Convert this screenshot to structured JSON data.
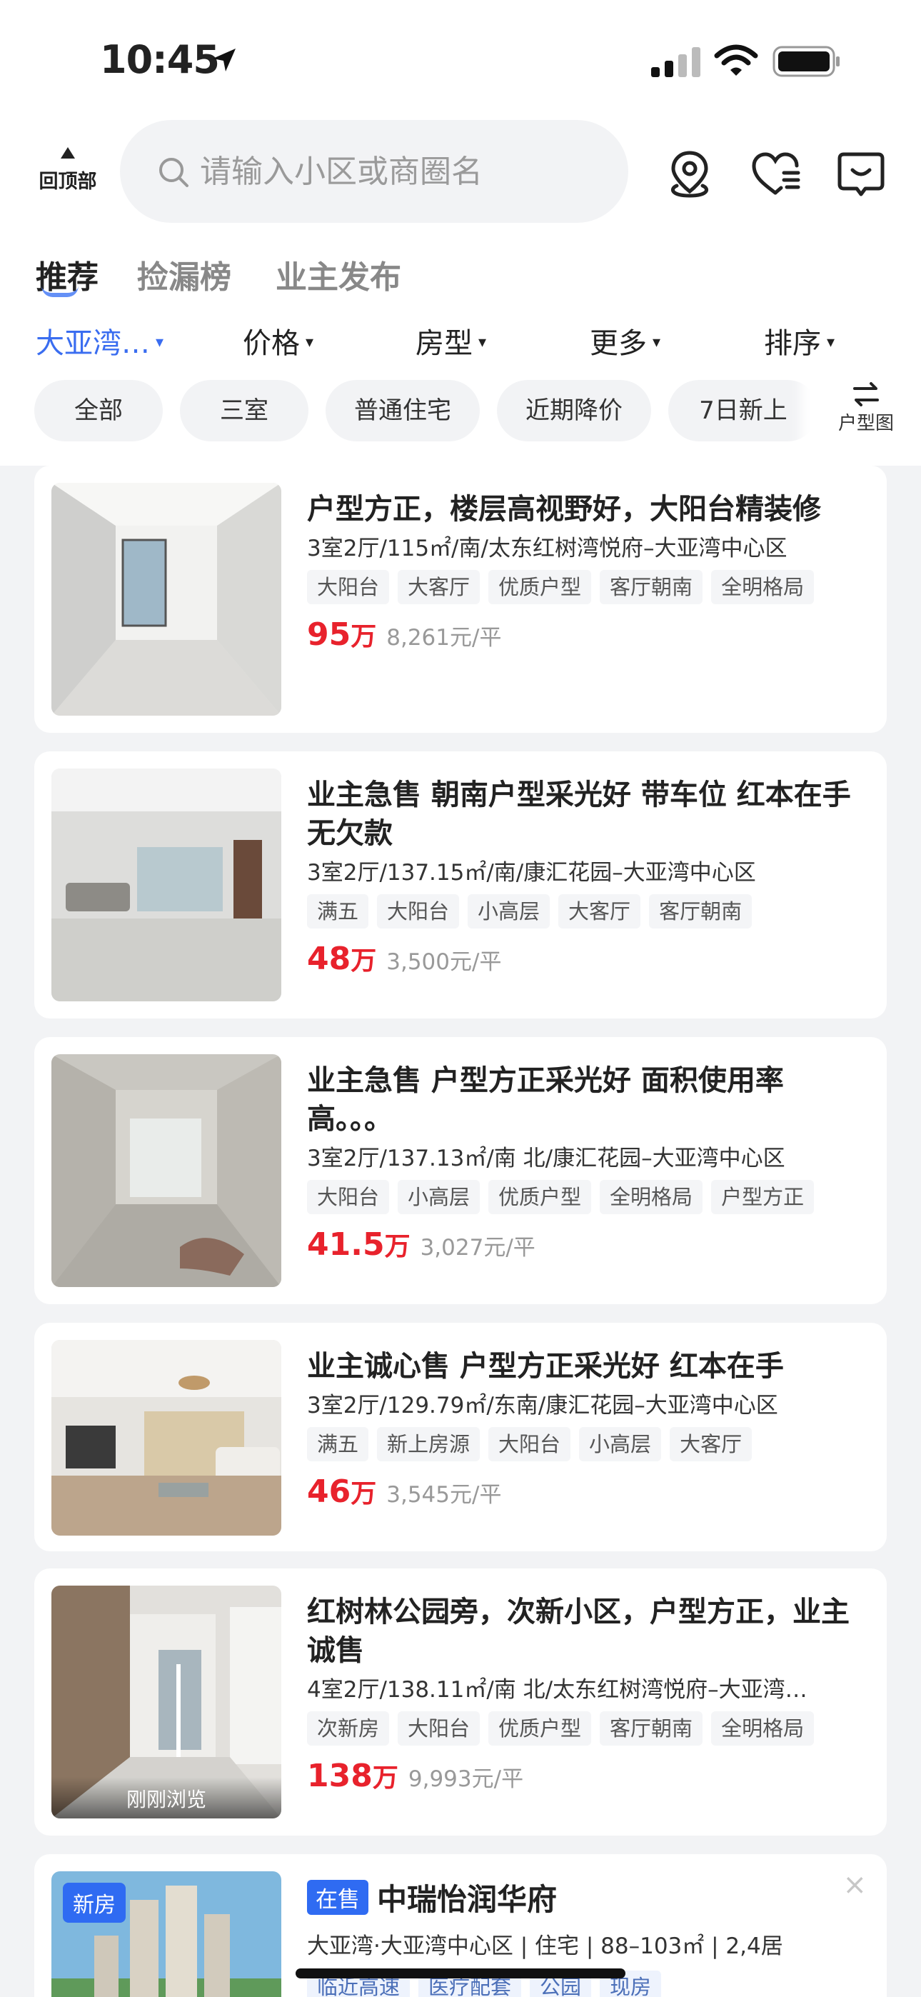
{
  "status_bar": {
    "time": "10:45"
  },
  "header": {
    "back_to_top": "回顶部",
    "search_placeholder": "请输入小区或商圈名"
  },
  "tabs": [
    {
      "label": "推荐",
      "active": true
    },
    {
      "label": "捡漏榜",
      "active": false
    },
    {
      "label": "业主发布",
      "active": false
    }
  ],
  "filters": [
    {
      "label": "大亚湾…",
      "active": true
    },
    {
      "label": "价格",
      "active": false
    },
    {
      "label": "房型",
      "active": false
    },
    {
      "label": "更多",
      "active": false
    },
    {
      "label": "排序",
      "active": false
    }
  ],
  "quick_chips": [
    "全部",
    "三室",
    "普通住宅",
    "近期降价",
    "7日新上"
  ],
  "layout_toggle": "户型图",
  "listings": [
    {
      "title": "户型方正，楼层高视野好，大阳台精装修",
      "meta": "3室2厅/115㎡/南/太东红树湾悦府–大亚湾中心区",
      "tags": [
        "大阳台",
        "大客厅",
        "优质户型",
        "客厅朝南",
        "全明格局"
      ],
      "price_num": "95",
      "price_unit": "万",
      "unit_price": "8,261元/平",
      "recently_viewed": ""
    },
    {
      "title": "业主急售 朝南户型采光好 带车位 红本在手无欠款",
      "meta": "3室2厅/137.15㎡/南/康汇花园–大亚湾中心区",
      "tags": [
        "满五",
        "大阳台",
        "小高层",
        "大客厅",
        "客厅朝南"
      ],
      "price_num": "48",
      "price_unit": "万",
      "unit_price": "3,500元/平",
      "recently_viewed": ""
    },
    {
      "title": "业主急售 户型方正采光好 面积使用率高。。。",
      "meta": "3室2厅/137.13㎡/南 北/康汇花园–大亚湾中心区",
      "tags": [
        "大阳台",
        "小高层",
        "优质户型",
        "全明格局",
        "户型方正"
      ],
      "price_num": "41.5",
      "price_unit": "万",
      "unit_price": "3,027元/平",
      "recently_viewed": ""
    },
    {
      "title": "业主诚心售 户型方正采光好  红本在手",
      "meta": "3室2厅/129.79㎡/东南/康汇花园–大亚湾中心区",
      "tags": [
        "满五",
        "新上房源",
        "大阳台",
        "小高层",
        "大客厅"
      ],
      "price_num": "46",
      "price_unit": "万",
      "unit_price": "3,545元/平",
      "recently_viewed": ""
    },
    {
      "title": "红树林公园旁，次新小区，户型方正，业主诚售",
      "meta": "4室2厅/138.11㎡/南 北/太东红树湾悦府–大亚湾…",
      "tags": [
        "次新房",
        "大阳台",
        "优质户型",
        "客厅朝南",
        "全明格局"
      ],
      "price_num": "138",
      "price_unit": "万",
      "unit_price": "9,993元/平",
      "recently_viewed": "刚刚浏览"
    }
  ],
  "new_house": {
    "badge": "新房",
    "status": "在售",
    "name": "中瑞怡润华府",
    "meta": "大亚湾·大亚湾中心区 | 住宅 | 88–103㎡ | 2,4居",
    "tags": [
      "临近高速",
      "医疗配套",
      "公园",
      "现房"
    ],
    "close": "×"
  }
}
